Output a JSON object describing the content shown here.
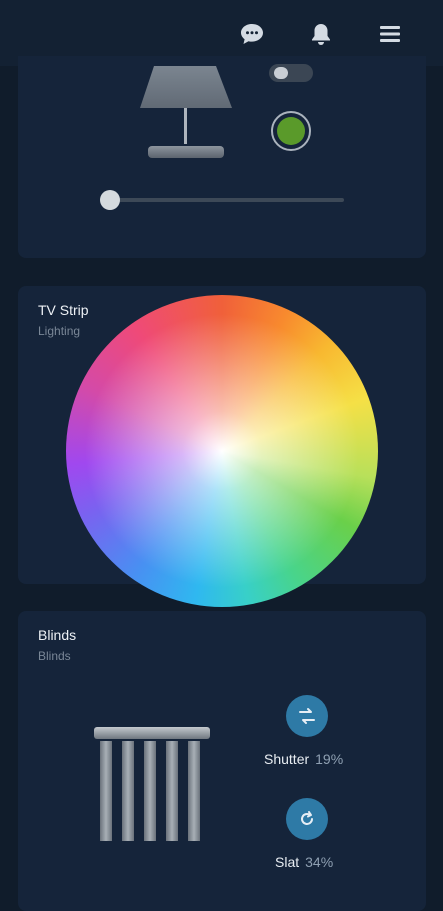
{
  "header": {
    "icons": [
      "chat-bubble-icon",
      "bell-icon",
      "menu-icon"
    ]
  },
  "lamp_card": {
    "toggle_state": "off",
    "color_swatch": "#5a9a2a",
    "brightness": 0.0
  },
  "tv_strip": {
    "title": "TV Strip",
    "subtitle": "Lighting"
  },
  "blinds": {
    "title": "Blinds",
    "subtitle": "Blinds",
    "shutter": {
      "label": "Shutter",
      "value": "19%"
    },
    "slat": {
      "label": "Slat",
      "value": "34%"
    }
  },
  "colors": {
    "background": "#101c2b",
    "card": "#15243a",
    "accent_button": "#2e7aa6",
    "swatch": "#5a9a2a"
  }
}
